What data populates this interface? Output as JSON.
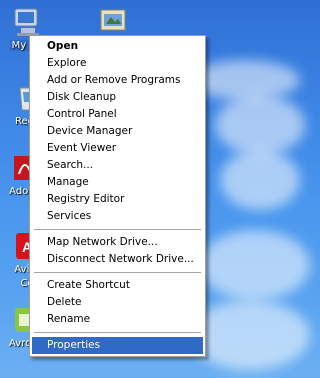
{
  "desktop": {
    "icons": [
      {
        "name": "my-computer-icon",
        "label": "My Co"
      },
      {
        "name": "recycle-bin-icon",
        "label": "Recy"
      },
      {
        "name": "adobe-icon",
        "label": "Adobe"
      },
      {
        "name": "avira-icon",
        "label": "Avira"
      },
      {
        "name": "avira-icon-2",
        "label": "Co"
      },
      {
        "name": "avro-icon",
        "label": "Avro K"
      }
    ],
    "folder_icon": "folder-shortcut-icon"
  },
  "menu": {
    "group1": [
      "Open",
      "Explore",
      "Add or Remove Programs",
      "Disk Cleanup",
      "Control Panel",
      "Device Manager",
      "Event Viewer",
      "Search...",
      "Manage",
      "Registry Editor",
      "Services"
    ],
    "group2": [
      "Map Network Drive...",
      "Disconnect Network Drive..."
    ],
    "group3": [
      "Create Shortcut",
      "Delete",
      "Rename"
    ],
    "group4": [
      "Properties"
    ],
    "default_item": "Open",
    "highlighted_item": "Properties",
    "highlight_color": "#316ac5"
  }
}
